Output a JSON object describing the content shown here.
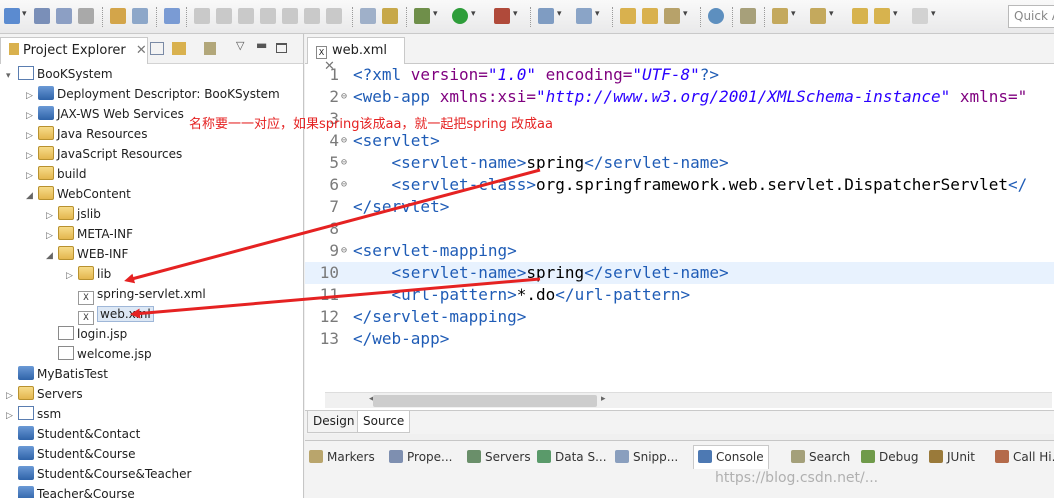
{
  "toolbar": {
    "quick_access_placeholder": "Quick Access"
  },
  "explorer": {
    "tab_title": "Project Explorer",
    "tree": [
      {
        "label": "BooKSystem",
        "icon": "project-icon",
        "twisty": "▾",
        "indent": 0
      },
      {
        "label": "Deployment Descriptor: BooKSystem",
        "icon": "deployment-descriptor-icon",
        "twisty": "▷",
        "indent": 1
      },
      {
        "label": "JAX-WS Web Services",
        "icon": "web-services-icon",
        "twisty": "▷",
        "indent": 1
      },
      {
        "label": "Java Resources",
        "icon": "java-resources-icon",
        "twisty": "▷",
        "indent": 1
      },
      {
        "label": "JavaScript Resources",
        "icon": "javascript-resources-icon",
        "twisty": "▷",
        "indent": 1
      },
      {
        "label": "build",
        "icon": "folder-icon",
        "twisty": "▷",
        "indent": 1
      },
      {
        "label": "WebContent",
        "icon": "folder-icon",
        "twisty": "◢",
        "indent": 1
      },
      {
        "label": "jslib",
        "icon": "folder-icon",
        "twisty": "▷",
        "indent": 2
      },
      {
        "label": "META-INF",
        "icon": "folder-icon",
        "twisty": "▷",
        "indent": 2
      },
      {
        "label": "WEB-INF",
        "icon": "folder-icon",
        "twisty": "◢",
        "indent": 2
      },
      {
        "label": "lib",
        "icon": "folder-icon",
        "twisty": "▷",
        "indent": 3
      },
      {
        "label": "spring-servlet.xml",
        "icon": "xml-file-icon",
        "twisty": "",
        "indent": 3
      },
      {
        "label": "web.xml",
        "icon": "xml-file-icon",
        "twisty": "",
        "indent": 3,
        "selected": true
      },
      {
        "label": "login.jsp",
        "icon": "jsp-file-icon",
        "twisty": "",
        "indent": 2
      },
      {
        "label": "welcome.jsp",
        "icon": "jsp-file-icon",
        "twisty": "",
        "indent": 2
      },
      {
        "label": "MyBatisTest",
        "icon": "closed-project-icon",
        "twisty": "",
        "indent": 0
      },
      {
        "label": "Servers",
        "icon": "folder-icon",
        "twisty": "▷",
        "indent": 0
      },
      {
        "label": "ssm",
        "icon": "project-icon",
        "twisty": "▷",
        "indent": 0
      },
      {
        "label": "Student&Contact",
        "icon": "closed-project-icon",
        "twisty": "",
        "indent": 0
      },
      {
        "label": "Student&Course",
        "icon": "closed-project-icon",
        "twisty": "",
        "indent": 0
      },
      {
        "label": "Student&Course&Teacher",
        "icon": "closed-project-icon",
        "twisty": "",
        "indent": 0
      },
      {
        "label": "Teacher&Course",
        "icon": "closed-project-icon",
        "twisty": "",
        "indent": 0
      }
    ]
  },
  "editor": {
    "tab_title": "web.xml",
    "lines": [
      {
        "n": "1",
        "fold": "",
        "html": "pi"
      },
      {
        "n": "2",
        "fold": "⊖",
        "html": "webapp"
      },
      {
        "n": "3",
        "fold": "",
        "html": "blank"
      },
      {
        "n": "4",
        "fold": "⊖",
        "html": "servlet_open"
      },
      {
        "n": "5",
        "fold": "⊖",
        "html": "servlet_name"
      },
      {
        "n": "6",
        "fold": "⊖",
        "html": "servlet_class"
      },
      {
        "n": "7",
        "fold": "",
        "html": "servlet_close"
      },
      {
        "n": "8",
        "fold": "",
        "html": "blank"
      },
      {
        "n": "9",
        "fold": "⊖",
        "html": "mapping_open"
      },
      {
        "n": "10",
        "fold": "",
        "html": "mapping_name"
      },
      {
        "n": "11",
        "fold": "",
        "html": "url_pattern"
      },
      {
        "n": "12",
        "fold": "",
        "html": "mapping_close"
      },
      {
        "n": "13",
        "fold": "",
        "html": "webapp_close"
      }
    ],
    "code": {
      "pi_open": "<?xml ",
      "pi_version_attr": "version=",
      "pi_version_val": "\"1.0\"",
      "pi_enc_attr": " encoding=",
      "pi_enc_val": "\"UTF-8\"",
      "pi_close": "?>",
      "webapp_open": "<web-app ",
      "xmlns_xsi_attr": "xmlns:xsi=",
      "xmlns_xsi_val": "\"http://www.w3.org/2001/XMLSchema-instance\"",
      "xmlns_attr": " xmlns=\"",
      "servlet_open": "<servlet>",
      "servlet_name_open": "<servlet-name>",
      "servlet_name_value": "spring",
      "servlet_name_close": "</servlet-name>",
      "servlet_class_open": "<servlet-class>",
      "servlet_class_value": "org.springframework.web.servlet.DispatcherServlet",
      "servlet_class_close": "</",
      "servlet_close": "</servlet>",
      "mapping_open": "<servlet-mapping>",
      "mapping_name_value": "spring",
      "url_open": "<url-pattern>",
      "url_value": "*.do",
      "url_close": "</url-pattern>",
      "mapping_close": "</servlet-mapping>",
      "webapp_close": "</web-app>"
    },
    "mode_tabs": [
      "Design",
      "Source"
    ]
  },
  "bottom_views": [
    {
      "label": "Markers",
      "icon": "markers-icon"
    },
    {
      "label": "Prope...",
      "icon": "properties-icon"
    },
    {
      "label": "Servers",
      "icon": "servers-icon"
    },
    {
      "label": "Data S...",
      "icon": "data-source-icon"
    },
    {
      "label": "Snipp...",
      "icon": "snippets-icon"
    },
    {
      "label": "Console",
      "icon": "console-icon",
      "active": true
    },
    {
      "label": "Search",
      "icon": "search-icon"
    },
    {
      "label": "Debug",
      "icon": "debug-icon"
    },
    {
      "label": "JUnit",
      "icon": "junit-icon"
    },
    {
      "label": "Call Hi...",
      "icon": "call-hierarchy-icon"
    }
  ],
  "watermark": "https://blog.csdn.net/...",
  "annotation": {
    "text": "名称要一一对应，如果spring该成aa，就一起把spring 改成aa",
    "color": "#e52222"
  },
  "colors": {
    "annotation_red": "#e52222",
    "xml_tag": "#1f5cb6",
    "xml_attr": "#7f007f",
    "xml_value": "#2a00ff"
  }
}
